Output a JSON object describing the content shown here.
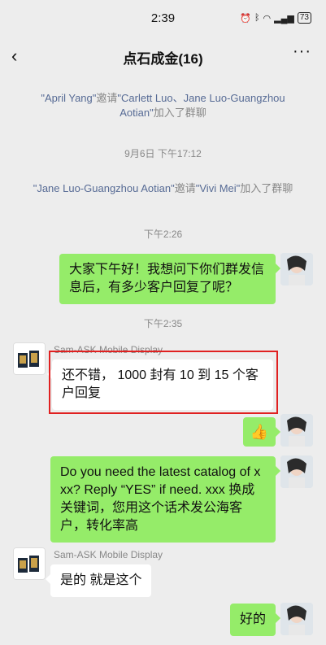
{
  "status": {
    "time": "2:39",
    "battery": "73"
  },
  "header": {
    "title": "点石成金(16)"
  },
  "system_messages": {
    "m1": {
      "p1": "\"April Yang\"",
      "p2": "邀请",
      "p3": "\"Carlett Luo、Jane Luo-Guangzhou Aotian\"",
      "p4": "加入了群聊"
    },
    "m2": {
      "p1": "\"Jane Luo-Guangzhou Aotian\"",
      "p2": "邀请",
      "p3": "\"Vivi Mei\"",
      "p4": "加入了群聊"
    }
  },
  "timestamps": {
    "t1": "9月6日 下午17:12",
    "t2": "下午2:26",
    "t3": "下午2:35"
  },
  "messages": {
    "msg1": "大家下午好！我想问下你们群发信息后，有多少客户回复了呢？",
    "msg2_sender": "Sam-ASK Mobile Display",
    "msg2": "还不错， 1000 封有 10 到 15 个客户回复",
    "msg3": "👍",
    "msg4": "Do you need the latest catalog of xxx?   Reply “YES” if need. xxx 换成关键词，您用这个话术发公海客户，转化率高",
    "msg5_sender": "Sam-ASK Mobile Display",
    "msg5": "是的 就是这个",
    "msg6": "好的"
  }
}
